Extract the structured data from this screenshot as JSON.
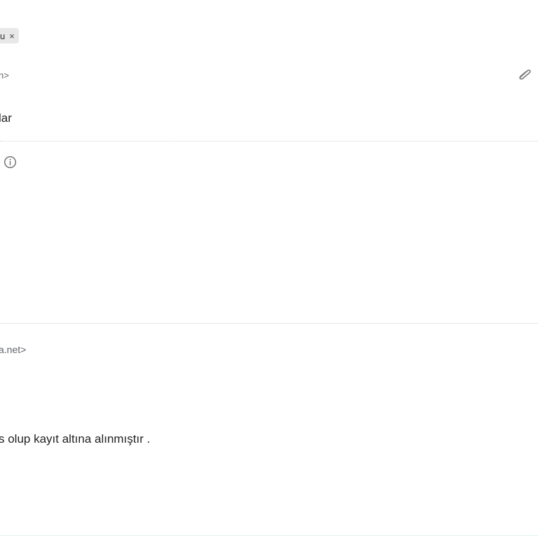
{
  "thread_header": {
    "label_chip": {
      "text": "u",
      "close_glyph": "×"
    }
  },
  "first_message": {
    "sender_email_fragment": "n>",
    "subject_fragment": "lar",
    "icons": [
      "paperclip-icon",
      "info-icon"
    ]
  },
  "second_message": {
    "sender_email_fragment": "a.net>",
    "body_fragment": "s olup kayıt altına alınmıştır ."
  },
  "colors": {
    "chip_background": "#e8e8e8",
    "secondary_text": "#5f6368",
    "primary_text": "#222222",
    "divider": "#e6e6e6"
  }
}
